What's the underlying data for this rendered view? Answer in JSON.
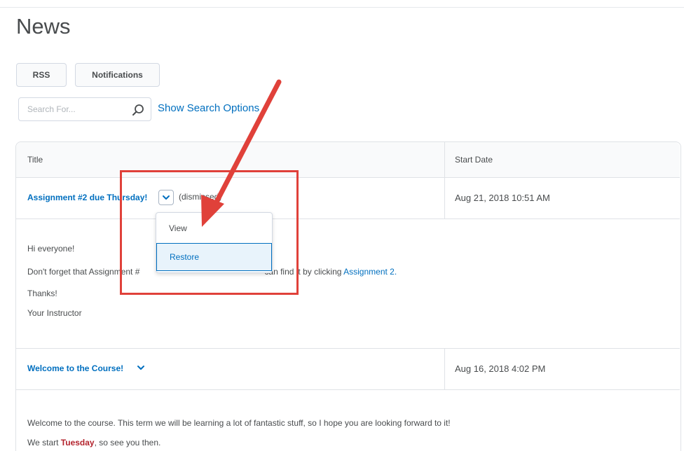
{
  "page": {
    "title": "News"
  },
  "toolbar": {
    "rss_label": "RSS",
    "notifications_label": "Notifications"
  },
  "search": {
    "placeholder": "Search For...",
    "options_label": "Show Search Options"
  },
  "table": {
    "columns": [
      "Title",
      "Start Date"
    ]
  },
  "items": [
    {
      "title": "Assignment #2 due Thursday!",
      "status": "(dismissed)",
      "date": "Aug 21, 2018 10:51 AM",
      "body": {
        "line1": "Hi everyone!",
        "line2_pre": "Don't forget that Assignment #",
        "line2_post": "can find it by clicking ",
        "link": "Assignment 2.",
        "line3": "Thanks!",
        "line4": "Your Instructor"
      }
    },
    {
      "title": "Welcome to the Course!",
      "date": "Aug 16, 2018 4:02 PM",
      "body": {
        "line1": "Welcome to the course.  This term we will be learning a lot of fantastic stuff, so I hope you are looking forward to it!",
        "line2_pre": "We start ",
        "highlight": "Tuesday",
        "line2_post": ", so see you then."
      }
    }
  ],
  "context_menu": {
    "items": [
      "View",
      "Restore"
    ]
  },
  "colors": {
    "link": "#006fbf",
    "annotation": "#e0413a",
    "highlight": "#b3232d"
  },
  "icons": [
    "search-icon",
    "chevron-down-icon"
  ]
}
